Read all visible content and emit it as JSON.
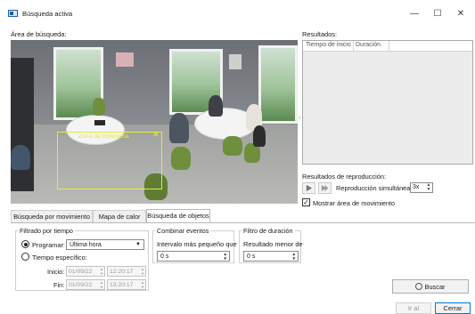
{
  "window": {
    "title": "Búsqueda activa",
    "minimize": "—",
    "maximize": "☐",
    "close": "✕"
  },
  "search_area": {
    "label": "Área de búsqueda:",
    "zone_label": "Zona de búsqueda",
    "zone_close": "✕"
  },
  "results": {
    "label": "Resultados:",
    "columns": [
      "Tiempo de inicio",
      "Duración"
    ]
  },
  "playback": {
    "label": "Resultados de reproducción:",
    "simultaneous_label": "Reproducción simultánea:",
    "simultaneous_value": "3x",
    "show_motion_area": "Mostrar área de movimiento",
    "show_motion_area_checked": true
  },
  "tabs": [
    {
      "label": "Búsqueda por movimiento",
      "active": false
    },
    {
      "label": "Mapa de calor",
      "active": false
    },
    {
      "label": "Búsqueda de objetos",
      "active": true
    }
  ],
  "time_filter": {
    "group_label": "Filtrado por tiempo",
    "schedule_label": "Programar:",
    "schedule_selected": true,
    "schedule_value": "Última hora",
    "specific_label": "Tiempo específico:",
    "start_label": "Inicio:",
    "start_date": "01/09/22",
    "start_time": "12:20:17",
    "end_label": "Fin:",
    "end_date": "01/09/22",
    "end_time": "13:20:17"
  },
  "combine_events": {
    "group_label": "Combinar eventos",
    "interval_label": "Intervalo más pequeño que",
    "interval_value": "0 s"
  },
  "duration_filter": {
    "group_label": "Filtro de duración",
    "result_label": "Resultado menor de",
    "result_value": "0 s"
  },
  "buttons": {
    "search": "Buscar",
    "goto_file": "Ir al archivo",
    "close": "Cerrar"
  }
}
